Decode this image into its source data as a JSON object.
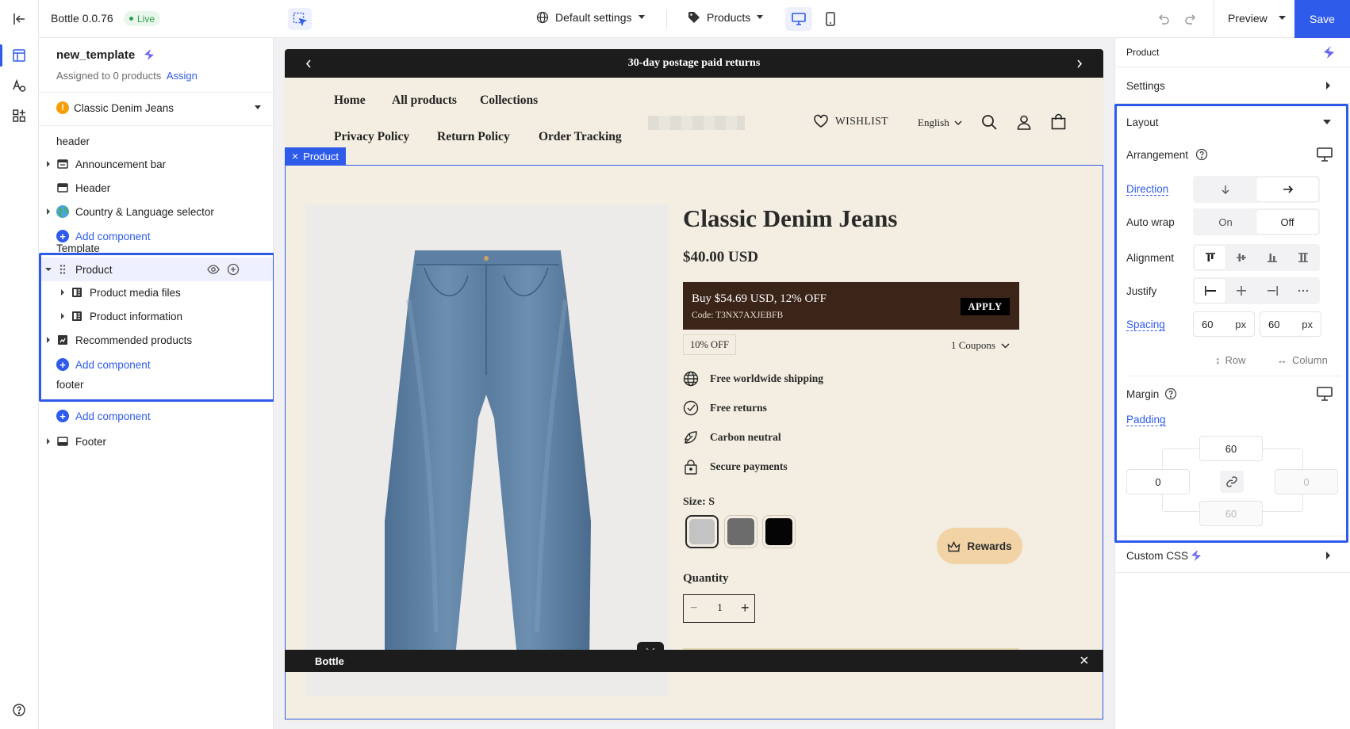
{
  "topbar": {
    "app_name": "Bottle 0.0.76",
    "status": "Live",
    "settings_dropdown": "Default settings",
    "products_dropdown": "Products",
    "preview_label": "Preview",
    "save_label": "Save"
  },
  "left": {
    "template_name": "new_template",
    "assigned_text": "Assigned to 0 products",
    "assign_link": "Assign",
    "product_select": "Classic Denim Jeans",
    "sections": {
      "header": "header",
      "template": "Template",
      "footer": "footer"
    },
    "header_items": [
      "Announcement bar",
      "Header",
      "Country & Language selector"
    ],
    "template_items": {
      "product": "Product",
      "media": "Product media files",
      "info": "Product information",
      "recommended": "Recommended products"
    },
    "footer_items": [
      "Footer"
    ],
    "add_component": "Add component"
  },
  "store": {
    "announcement": "30-day postage paid returns",
    "nav_row1": [
      "Home",
      "All products",
      "Collections"
    ],
    "nav_row2": [
      "Privacy Policy",
      "Return Policy",
      "Order Tracking"
    ],
    "wishlist": "WISHLIST",
    "language": "English",
    "selection_tag": "Product",
    "product_title": "Classic Denim Jeans",
    "price": "$40.00 USD",
    "promo_title": "Buy $54.69 USD, 12% OFF",
    "promo_code": "Code: T3NX7AXJEBFB",
    "apply": "APPLY",
    "discount_badge": "10% OFF",
    "coupons": "1 Coupons",
    "features": [
      "Free worldwide shipping",
      "Free returns",
      "Carbon neutral",
      "Secure payments"
    ],
    "size_label": "Size: S",
    "swatches": [
      "#c3c3c3",
      "#6c6c6c",
      "#050505"
    ],
    "quantity_label": "Quantity",
    "quantity_value": "1",
    "rewards": "Rewards",
    "bottom_bar_title": "Bottle"
  },
  "right": {
    "breadcrumb": "Product",
    "settings": "Settings",
    "layout": "Layout",
    "arrangement": "Arrangement",
    "direction": "Direction",
    "auto_wrap": "Auto wrap",
    "auto_wrap_on": "On",
    "auto_wrap_off": "Off",
    "alignment": "Alignment",
    "justify": "Justify",
    "spacing": "Spacing",
    "spacing_row_value": "60",
    "spacing_col_value": "60",
    "unit": "px",
    "row_label": "Row",
    "column_label": "Column",
    "margin": "Margin",
    "padding": "Padding",
    "padding_top": "60",
    "padding_left": "0",
    "padding_right": "0",
    "padding_bottom": "60",
    "custom_css": "Custom CSS"
  },
  "colors": {
    "accent": "#2f5bea",
    "live_green": "#2e9e4d",
    "store_bg": "#f3eee1",
    "promo_bg": "#3b2418",
    "dark_bar": "#1c1c1c",
    "rewards_bg": "#f2d3a6"
  }
}
